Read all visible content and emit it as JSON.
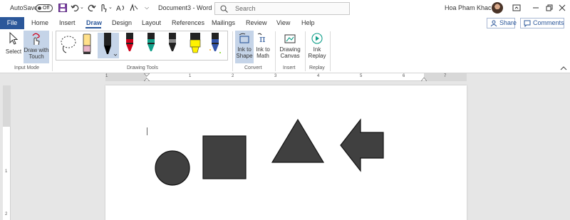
{
  "titlebar": {
    "autosave_label": "AutoSave",
    "autosave_state": "Off",
    "doc_title": "Document3 - Word",
    "search_placeholder": "Search",
    "user_name": "Hoa Pham Khac"
  },
  "tabs": [
    "File",
    "Home",
    "Insert",
    "Draw",
    "Design",
    "Layout",
    "References",
    "Mailings",
    "Review",
    "View",
    "Help"
  ],
  "active_tab": "Draw",
  "share_label": "Share",
  "comments_label": "Comments",
  "ribbon": {
    "select_label": "Select",
    "draw_touch_line1": "Draw with",
    "draw_touch_line2": "Touch",
    "input_mode_label": "Input Mode",
    "drawing_tools_label": "Drawing Tools",
    "ink_shape_line1": "Ink to",
    "ink_shape_line2": "Shape",
    "ink_math_line1": "Ink to",
    "ink_math_line2": "Math",
    "convert_label": "Convert",
    "canvas_line1": "Drawing",
    "canvas_line2": "Canvas",
    "insert_label": "Insert",
    "replay_line1": "Ink",
    "replay_line2": "Replay",
    "replay_label": "Replay"
  },
  "pens": [
    {
      "name": "lasso-select",
      "color": "#ffffff"
    },
    {
      "name": "pencil-eraser",
      "color": "#e8b4c8"
    },
    {
      "name": "pen-black",
      "color": "#000000"
    },
    {
      "name": "pen-red",
      "color": "#d0021b"
    },
    {
      "name": "pen-teal",
      "color": "#12a08a"
    },
    {
      "name": "pen-dark",
      "color": "#222222"
    },
    {
      "name": "highlighter-yellow",
      "color": "#fff200"
    },
    {
      "name": "pen-galaxy",
      "color": "#3355aa"
    }
  ],
  "ruler": {
    "h_numbers": [
      "1",
      "1",
      "2",
      "3",
      "4",
      "5",
      "6",
      "7"
    ],
    "v_numbers": [
      "1",
      "2"
    ]
  },
  "shapes": {
    "fill": "#404040",
    "stroke": "#111111",
    "items": [
      "circle",
      "square",
      "triangle",
      "left-arrow"
    ]
  }
}
